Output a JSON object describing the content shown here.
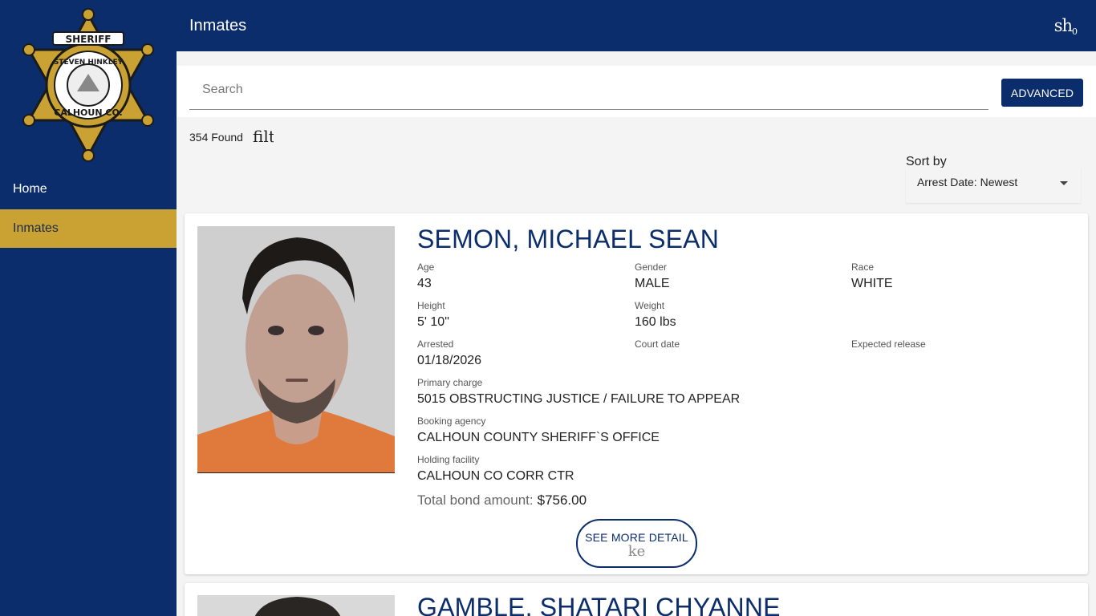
{
  "logo": {
    "top_text": "SHERIFF",
    "middle_text": "STEVEN HINKLEY",
    "bottom_text": "CALHOUN CO."
  },
  "sidebar": {
    "items": [
      {
        "label": "Home",
        "active": false
      },
      {
        "label": "Inmates",
        "active": true
      }
    ]
  },
  "header": {
    "title": "Inmates",
    "icon_text": "sh",
    "icon_badge": "0"
  },
  "search": {
    "placeholder": "Search",
    "value": "",
    "advanced_label": "ADVANCED"
  },
  "results": {
    "found_text": "354 Found",
    "filter_icon_text": "filt"
  },
  "sort": {
    "label": "Sort by",
    "selected": "Arrest Date: Newest"
  },
  "colors": {
    "navy": "#0b2d6b",
    "gold": "#c9a233"
  },
  "inmates": [
    {
      "name": "SEMON, MICHAEL SEAN",
      "age_label": "Age",
      "age": "43",
      "gender_label": "Gender",
      "gender": "MALE",
      "race_label": "Race",
      "race": "WHITE",
      "height_label": "Height",
      "height": "5' 10\"",
      "weight_label": "Weight",
      "weight": "160 lbs",
      "arrested_label": "Arrested",
      "arrested": "01/18/2026",
      "court_label": "Court date",
      "court": "",
      "release_label": "Expected release",
      "release": "",
      "charge_label": "Primary charge",
      "charge": "5015 OBSTRUCTING JUSTICE / FAILURE TO APPEAR",
      "agency_label": "Booking agency",
      "agency": "CALHOUN COUNTY SHERIFF`S OFFICE",
      "facility_label": "Holding facility",
      "facility": "CALHOUN CO CORR CTR",
      "bond_label": "Total bond amount:",
      "bond": "$756.00",
      "detail_label": "SEE MORE DETAIL",
      "detail_icon_text": "ke"
    },
    {
      "name": "GAMBLE, SHATARI CHYANNE"
    }
  ]
}
